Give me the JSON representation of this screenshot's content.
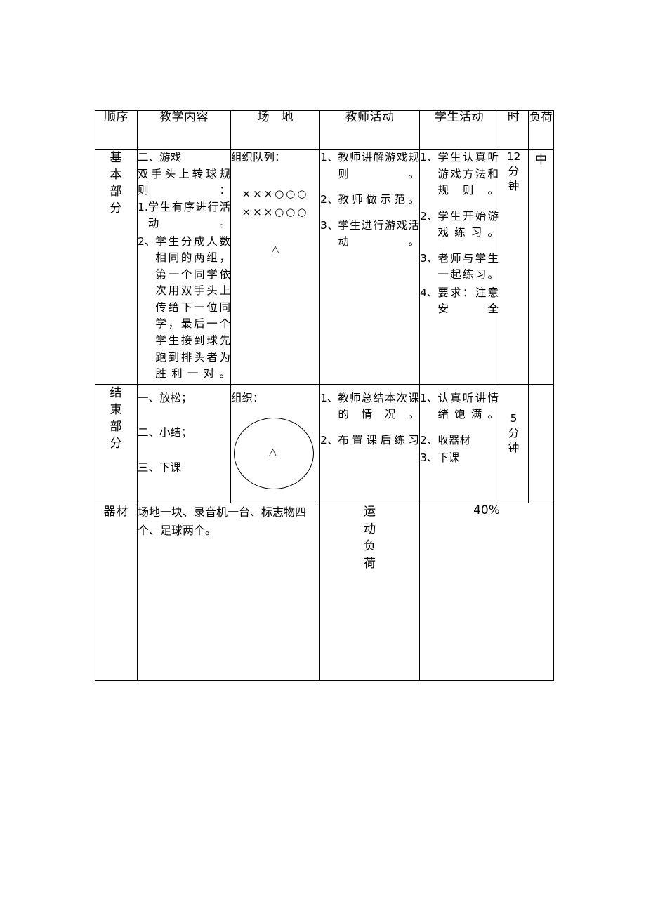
{
  "table": {
    "headers": {
      "order": "顺序",
      "content": "教学内容",
      "field": "场　地",
      "teacher": "教师活动",
      "student": "学生活动",
      "time": "时",
      "load": "负荷"
    },
    "rows": [
      {
        "order": "基本部分",
        "content": {
          "heading": "二、游戏",
          "subheading": "双手头上转球规则：",
          "items": [
            {
              "marker": "1.",
              "text": "学生有序进行活动。"
            },
            {
              "marker": "2、",
              "text": "学生分成人数相同的两组，第一个同学依次用双手头上传给下一位同学，最后一个学生接到球先跑到排头者为胜利一对。"
            }
          ]
        },
        "field": {
          "label": "组织队列：",
          "formation_rows": [
            "×××○○○",
            "×××○○○"
          ],
          "teacher_mark": "△"
        },
        "teacher": [
          {
            "marker": "1、",
            "text": "教师讲解游戏规则。"
          },
          {
            "marker": "2、",
            "text": "教师做示范。"
          },
          {
            "marker": "3、",
            "text": "学生进行游戏活动。"
          }
        ],
        "student": [
          {
            "marker": "1、",
            "text": "学生认真听游戏方法和规则。"
          },
          {
            "marker": "2、",
            "text": "学生开始游戏练习。"
          },
          {
            "marker": "3、",
            "text": "老师与学生一起练习。"
          },
          {
            "marker": "4、",
            "text": "要求：注意安全"
          }
        ],
        "time": [
          "12",
          "分",
          "钟"
        ],
        "load": "中"
      },
      {
        "order": "结束部分",
        "content": {
          "lines": [
            "一、放松；",
            "二、小结；",
            "三、下课"
          ]
        },
        "field": {
          "label": "组织：",
          "shape": "ellipse",
          "teacher_mark": "△"
        },
        "teacher": [
          {
            "marker": "1、",
            "text": "教师总结本次课的情况。"
          },
          {
            "marker": "2、",
            "text": "布置课后练习"
          }
        ],
        "student": [
          {
            "marker": "1、",
            "text": "认真听讲情绪饱满。"
          },
          {
            "marker": "2、",
            "text": "收器材"
          },
          {
            "marker": "3、",
            "text": "下课"
          }
        ],
        "time": [
          "5",
          "分",
          "钟"
        ],
        "load": ""
      }
    ],
    "footer": {
      "equipment_label": "器材",
      "equipment_text": "场地一块、录音机一台、标志物四个、足球两个。",
      "load_label": "运动负荷",
      "load_value": "40%"
    }
  }
}
